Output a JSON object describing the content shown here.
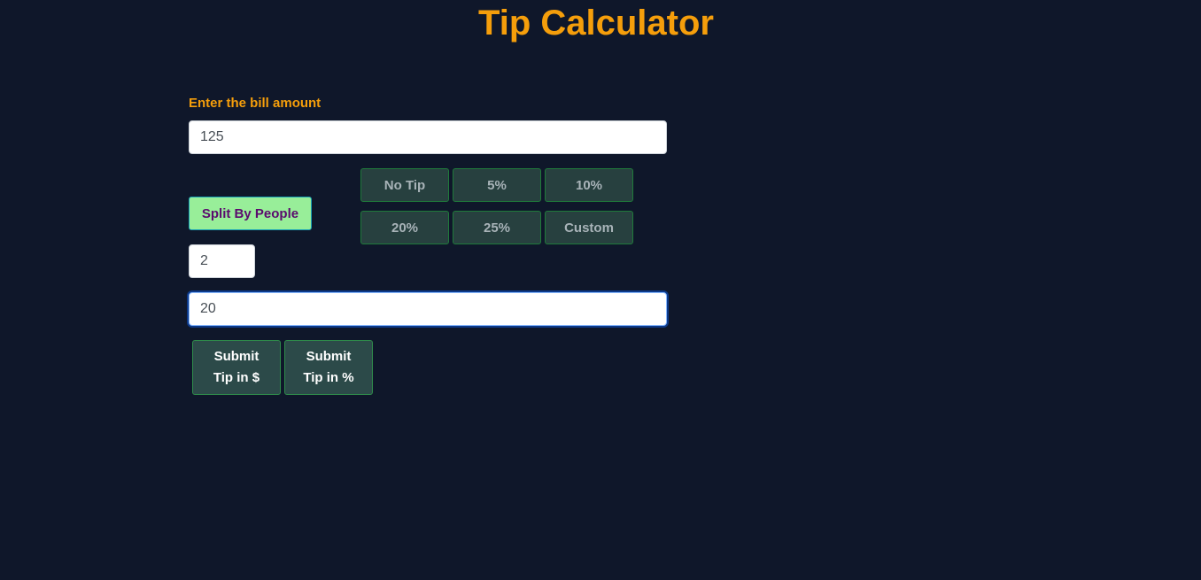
{
  "title": "Tip Calculator",
  "bill": {
    "label": "Enter the bill amount",
    "value": "125"
  },
  "split": {
    "button_label": "Split By People",
    "people_value": "2"
  },
  "tip_options": [
    "No Tip",
    "5%",
    "10%",
    "20%",
    "25%",
    "Custom"
  ],
  "custom_tip": {
    "value": "20"
  },
  "submit": {
    "dollar_line1": "Submit",
    "dollar_line2": "Tip in $",
    "percent_line1": "Submit",
    "percent_line2": "Tip in %"
  },
  "colors": {
    "background": "#0f172a",
    "accent": "#f59e0b",
    "split_button": "#98ee99",
    "tip_button": "#27403f"
  }
}
